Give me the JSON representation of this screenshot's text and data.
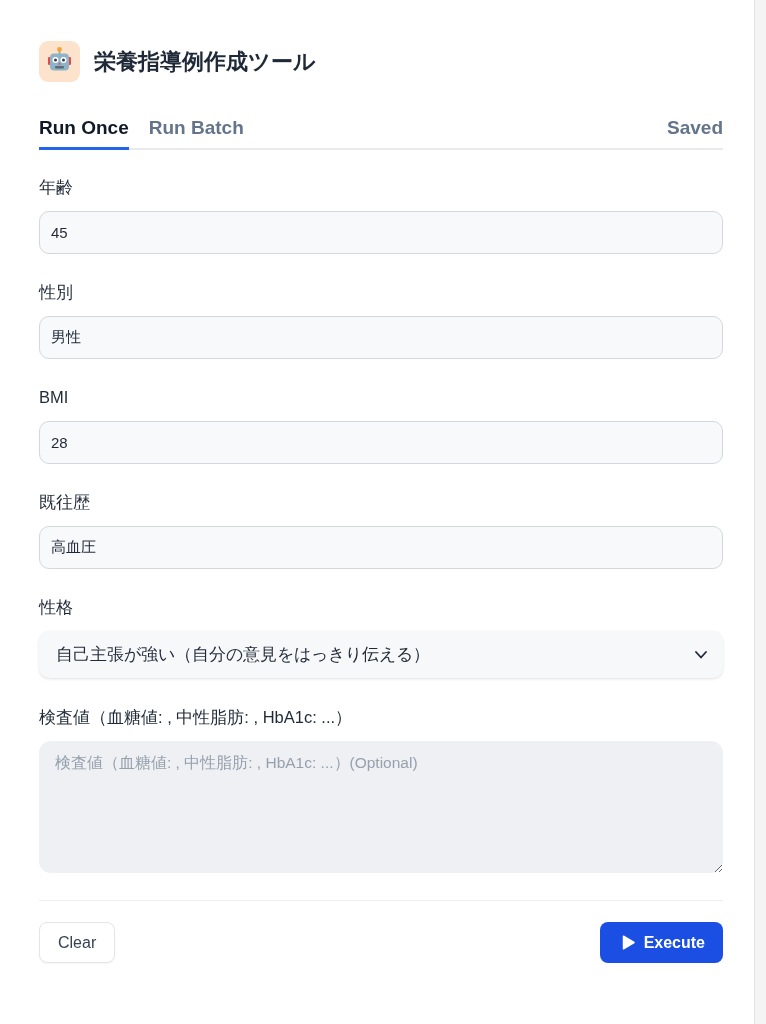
{
  "app": {
    "title": "栄養指導例作成ツール"
  },
  "tabs": [
    {
      "label": "Run Once",
      "selected": true
    },
    {
      "label": "Run Batch",
      "selected": false
    }
  ],
  "status": "Saved",
  "fields": [
    {
      "kind": "text",
      "label": "年齢",
      "value": "45"
    },
    {
      "kind": "text",
      "label": "性別",
      "value": "男性"
    },
    {
      "kind": "text",
      "label": "BMI",
      "value": "28"
    },
    {
      "kind": "text",
      "label": "既往歴",
      "value": "高血圧"
    },
    {
      "kind": "select",
      "label": "性格",
      "value": "自己主張が強い（自分の意見をはっきり伝える）"
    },
    {
      "kind": "textarea",
      "label": "検査値（血糖値: , 中性脂肪: , HbA1c: ...）",
      "placeholder": "検査値（血糖値: , 中性脂肪: , HbA1c: ...）(Optional)"
    }
  ],
  "buttons": [
    {
      "kind": "secondary",
      "label": "Clear"
    },
    {
      "kind": "primary",
      "label": "Execute"
    }
  ]
}
